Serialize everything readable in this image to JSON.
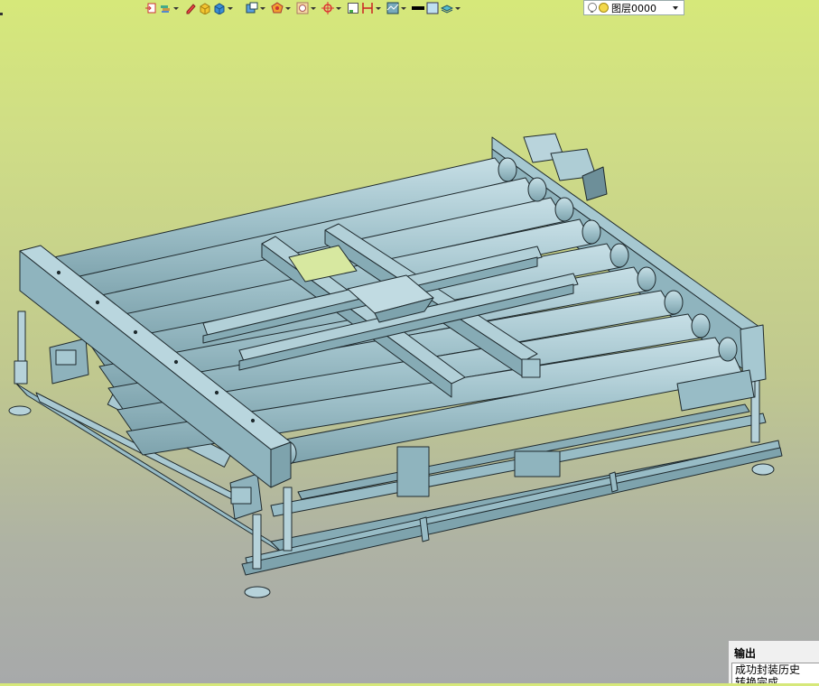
{
  "toolbar": {
    "buttons": [
      {
        "icon": "insert-part-icon",
        "dropdown": false
      },
      {
        "icon": "layers-stack-icon",
        "dropdown": true
      },
      {
        "icon": "pencil-icon",
        "dropdown": false
      },
      {
        "icon": "solid-cube-icon",
        "dropdown": false
      },
      {
        "icon": "shaded-box-icon",
        "dropdown": true
      },
      {
        "icon": "view-orient-icon",
        "dropdown": true
      },
      {
        "icon": "render-style-icon",
        "dropdown": true
      },
      {
        "icon": "display-filter-icon",
        "dropdown": true
      },
      {
        "icon": "snap-target-icon",
        "dropdown": true
      },
      {
        "icon": "frame-icon",
        "dropdown": false
      },
      {
        "icon": "dimension-icon",
        "dropdown": true
      },
      {
        "icon": "pattern-icon",
        "dropdown": true
      },
      {
        "icon": "line-color-icon",
        "dropdown": false
      },
      {
        "icon": "fill-color-icon",
        "dropdown": false
      },
      {
        "icon": "layer-stack-icon",
        "dropdown": true
      }
    ],
    "layer_select": {
      "value": "图层0000",
      "icons": [
        "lightbulb-icon",
        "sun-icon"
      ]
    }
  },
  "colors": {
    "background_top": "#d6e87a",
    "background_bottom": "#a7a9aa",
    "model_fill": "#9fc2cc",
    "model_dark": "#7aa1ac",
    "model_edge": "#1f2a2e"
  },
  "output_panel": {
    "title": "输出",
    "lines": [
      "成功封装历史",
      "转换完成"
    ]
  }
}
